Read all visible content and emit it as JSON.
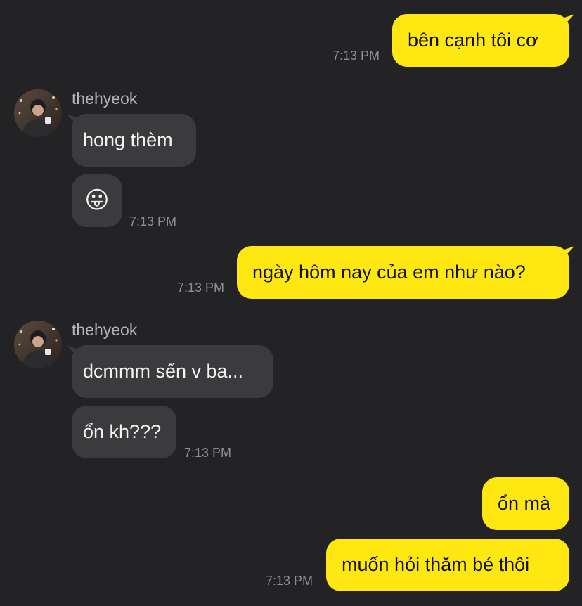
{
  "chat": {
    "messages": [
      {
        "sender": "me",
        "text": "bên cạnh tôi cơ",
        "time": "7:13 PM"
      },
      {
        "sender": "thehyeok",
        "name": "thehyeok",
        "text": "hong thèm"
      },
      {
        "sender": "thehyeok",
        "text": "😛",
        "time": "7:13 PM"
      },
      {
        "sender": "me",
        "text": "ngày hôm nay của em như nào?",
        "time": "7:13 PM"
      },
      {
        "sender": "thehyeok",
        "name": "thehyeok",
        "text": "dcmmm sến v ba..."
      },
      {
        "sender": "thehyeok",
        "text": "ổn kh???",
        "time": "7:13 PM"
      },
      {
        "sender": "me",
        "text": "ổn mà"
      },
      {
        "sender": "me",
        "text": "muốn hỏi thăm bé thôi",
        "time": "7:13 PM"
      }
    ]
  },
  "colors": {
    "background": "#232325",
    "outgoing_bubble": "#FFE812",
    "incoming_bubble": "#3B3B3D",
    "timestamp": "#8E8E93"
  },
  "icons": {
    "avatar": "profile-photo"
  }
}
